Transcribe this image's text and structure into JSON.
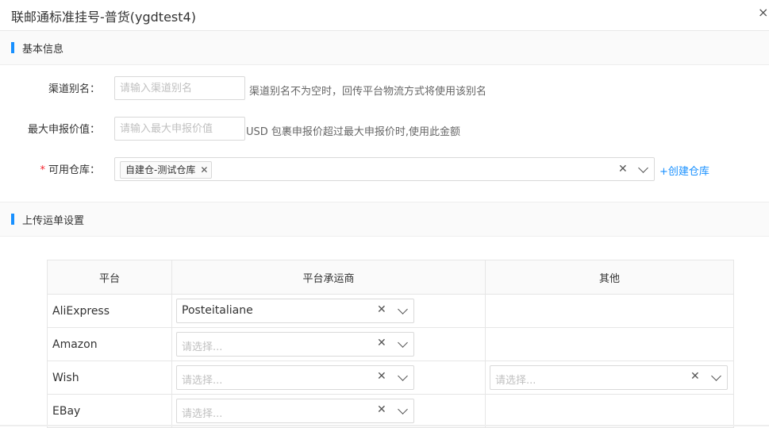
{
  "dialog": {
    "title": "联邮通标准挂号-普货(ygdtest4)",
    "close_glyph": "×"
  },
  "sections": {
    "basic": "基本信息",
    "upload": "上传运单设置"
  },
  "form": {
    "alias": {
      "label": "渠道别名：",
      "placeholder": "请输入渠道别名",
      "hint": "渠道别名不为空时，回传平台物流方式将使用该别名"
    },
    "max_declare": {
      "label": "最大申报价值：",
      "placeholder": "请输入最大申报价值",
      "hint": "USD 包裹申报价超过最大申报价时,使用此金额"
    },
    "warehouse": {
      "required_mark": "*",
      "label": "可用仓库：",
      "tag": "自建仓-测试仓库",
      "tag_remove": "✕",
      "create_link": "+创建仓库"
    }
  },
  "icons": {
    "clear": "✕"
  },
  "table": {
    "headers": [
      "平台",
      "平台承运商",
      "其他"
    ],
    "rows": [
      {
        "platform": "AliExpress",
        "carrier": "Posteitaliane",
        "carrier_placeholder": "",
        "other_placeholder": ""
      },
      {
        "platform": "Amazon",
        "carrier": "",
        "carrier_placeholder": "请选择...",
        "other_placeholder": ""
      },
      {
        "platform": "Wish",
        "carrier": "",
        "carrier_placeholder": "请选择...",
        "other_placeholder": "请选择..."
      },
      {
        "platform": "EBay",
        "carrier": "",
        "carrier_placeholder": "请选择...",
        "other_placeholder": ""
      }
    ]
  }
}
